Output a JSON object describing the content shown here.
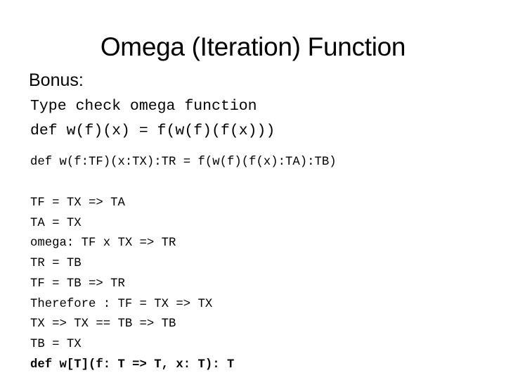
{
  "slide": {
    "title": "Omega (Iteration) Function",
    "heading": "Bonus:",
    "intro_lines": [
      "Type check omega function",
      "def w(f)(x) = f(w(f)(f(x)))"
    ],
    "annotated_def": "def w(f:TF)(x:TX):TR = f(w(f)(f(x):TA):TB)",
    "steps": [
      "TF = TX => TA",
      "TA = TX",
      "omega: TF x TX => TR",
      "TR = TB",
      "TF = TB => TR",
      "Therefore : TF = TX => TX",
      "TX => TX == TB => TB",
      "TB = TX"
    ],
    "final_def": "def w[T](f: T => T, x: T): T"
  }
}
